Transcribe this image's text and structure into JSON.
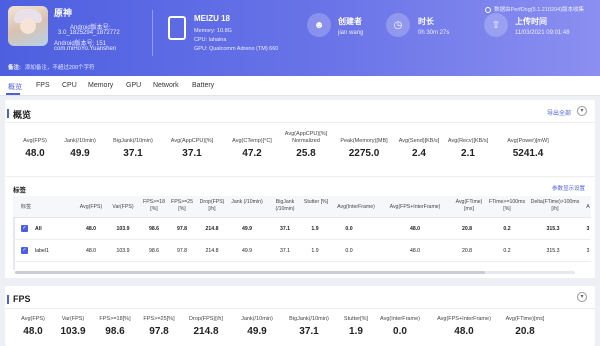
{
  "app": {
    "name": "原神",
    "android_version": "Android版本号:",
    "version": "3.0_1825294_1872772",
    "android_code": "Android版本号: 151",
    "package": "com.miHoYo.Yuanshen"
  },
  "device": {
    "title": "MEIZU 18",
    "memory": "Memory: 10.8G",
    "cpu": "CPU: lahaina",
    "gpu": "GPU: Qualcomm Adreno (TM) 660"
  },
  "stats": {
    "creator_label": "创建者",
    "creator_value": "jian wang",
    "duration_label": "时长",
    "duration_value": "0h 30m 27s",
    "upload_label": "上传时间",
    "upload_value": "11/03/2021 09:01:48"
  },
  "version_text": "数据由PerfDog(5.1.210204)版本收集",
  "remark": {
    "label": "备注:",
    "placeholder": "添加备注，不超过200个字符"
  },
  "tabs": [
    "概览",
    "FPS",
    "CPU",
    "Memory",
    "GPU",
    "Network",
    "Battery"
  ],
  "overview": {
    "title": "概览",
    "export": "导出全部",
    "metrics": [
      {
        "label": "Avg(FPS)",
        "value": "48.0"
      },
      {
        "label": "Jank(/10min)",
        "value": "49.9"
      },
      {
        "label": "BigJank(/10min)",
        "value": "37.1"
      },
      {
        "label": "Avg(AppCPU)[%]",
        "value": "37.1"
      },
      {
        "label": "Avg(CTemp)[°C]",
        "value": "47.2"
      },
      {
        "label": "Avg(AppCPU)[%] Normalized",
        "value": "25.8"
      },
      {
        "label": "Peak(Memory)[MB]",
        "value": "2275.0"
      },
      {
        "label": "Avg(Send)[KB/s]",
        "value": "2.4"
      },
      {
        "label": "Avg(Recv)[KB/s]",
        "value": "2.1"
      },
      {
        "label": "Avg(Power)[mW]",
        "value": "5241.4"
      }
    ],
    "labels_title": "标签",
    "settings_link": "参数显示设置"
  },
  "table": {
    "headers": [
      "标签",
      "Avg(FPS)",
      "Var(FPS)",
      "FPS>=18 [%]",
      "FPS>=25 [%]",
      "Drop(FPS) [/h]",
      "Jank (/10min)",
      "BigJank (/10min)",
      "Stutter [%]",
      "Avg(InterFrame)",
      "Avg(FPS+InterFrame)",
      "Avg(FTime) [ms]",
      "FTime>=100ms [%]",
      "Delta(FTime)>100ms [/h]",
      "A"
    ],
    "rows": [
      {
        "name": "All",
        "cells": [
          "48.0",
          "103.9",
          "98.6",
          "97.8",
          "214.8",
          "49.9",
          "37.1",
          "1.9",
          "0.0",
          "48.0",
          "20.8",
          "0.2",
          "315.3",
          "3"
        ]
      },
      {
        "name": "label1",
        "cells": [
          "48.0",
          "103.9",
          "98.6",
          "97.8",
          "214.8",
          "49.9",
          "37.1",
          "1.9",
          "0.0",
          "48.0",
          "20.8",
          "0.2",
          "315.3",
          "3"
        ]
      }
    ]
  },
  "fps": {
    "title": "FPS",
    "metrics": [
      {
        "label": "Avg(FPS)",
        "value": "48.0"
      },
      {
        "label": "Var(FPS)",
        "value": "103.9"
      },
      {
        "label": "FPS>=18[%]",
        "value": "98.6"
      },
      {
        "label": "FPS>=25[%]",
        "value": "97.8"
      },
      {
        "label": "Drop(FPS)[/h]",
        "value": "214.8"
      },
      {
        "label": "Jank(/10min)",
        "value": "49.9"
      },
      {
        "label": "BigJank(/10min)",
        "value": "37.1"
      },
      {
        "label": "Stutter[%]",
        "value": "1.9"
      },
      {
        "label": "Avg(InterFrame)",
        "value": "0.0"
      },
      {
        "label": "Avg(FPS+InterFrame)",
        "value": "48.0"
      },
      {
        "label": "Avg(FTime)[ms]",
        "value": "20.8"
      }
    ]
  },
  "colors": {
    "accent": "#4d5fe0",
    "header_end": "#8a8ff0"
  },
  "icons": [
    "phone-icon",
    "user-icon",
    "clock-icon",
    "upload-time-icon",
    "info-icon",
    "chevron-down-icon",
    "check-icon"
  ]
}
